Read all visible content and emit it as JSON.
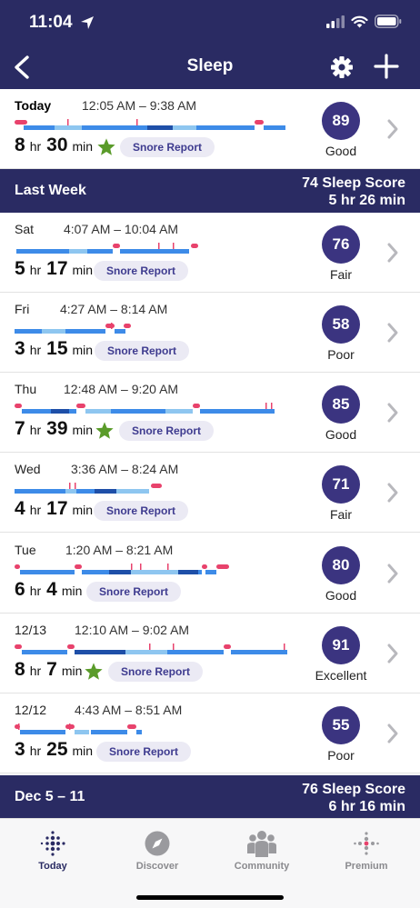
{
  "status_bar": {
    "time": "11:04"
  },
  "nav": {
    "title": "Sleep"
  },
  "today": {
    "day": "Today",
    "range": "12:05 AM – 9:38 AM",
    "hr": "8",
    "hr_unit": "hr",
    "min": "30",
    "min_unit": "min",
    "snore": "Snore Report",
    "score": "89",
    "label": "Good",
    "star": true
  },
  "weeks": [
    {
      "name": "Last Week",
      "score_line": "74 Sleep Score",
      "duration_line": "5 hr 26 min"
    },
    {
      "name": "Dec 5 – 11",
      "score_line": "76 Sleep Score",
      "duration_line": "6 hr 16 min"
    }
  ],
  "nights": [
    {
      "day": "Sat",
      "range": "4:07 AM – 10:04 AM",
      "hr": "5",
      "hr_unit": "hr",
      "min": "17",
      "min_unit": "min",
      "snore": "Snore Report",
      "score": "76",
      "label": "Fair",
      "star": false
    },
    {
      "day": "Fri",
      "range": "4:27 AM – 8:14 AM",
      "hr": "3",
      "hr_unit": "hr",
      "min": "15",
      "min_unit": "min",
      "snore": "Snore Report",
      "score": "58",
      "label": "Poor",
      "star": false
    },
    {
      "day": "Thu",
      "range": "12:48 AM – 9:20 AM",
      "hr": "7",
      "hr_unit": "hr",
      "min": "39",
      "min_unit": "min",
      "snore": "Snore Report",
      "score": "85",
      "label": "Good",
      "star": true
    },
    {
      "day": "Wed",
      "range": "3:36 AM – 8:24 AM",
      "hr": "4",
      "hr_unit": "hr",
      "min": "17",
      "min_unit": "min",
      "snore": "Snore Report",
      "score": "71",
      "label": "Fair",
      "star": false
    },
    {
      "day": "Tue",
      "range": "1:20 AM – 8:21 AM",
      "hr": "6",
      "hr_unit": "hr",
      "min": "4",
      "min_unit": "min",
      "snore": "Snore Report",
      "score": "80",
      "label": "Good",
      "star": false
    },
    {
      "day": "12/13",
      "range": "12:10 AM – 9:02 AM",
      "hr": "8",
      "hr_unit": "hr",
      "min": "7",
      "min_unit": "min",
      "snore": "Snore Report",
      "score": "91",
      "label": "Excellent",
      "star": true
    },
    {
      "day": "12/12",
      "range": "4:43 AM – 8:51 AM",
      "hr": "3",
      "hr_unit": "hr",
      "min": "25",
      "min_unit": "min",
      "snore": "Snore Report",
      "score": "55",
      "label": "Poor",
      "star": false
    }
  ],
  "tabs": [
    {
      "label": "Today",
      "icon": "fitbit-dots-icon"
    },
    {
      "label": "Discover",
      "icon": "compass-icon"
    },
    {
      "label": "Community",
      "icon": "people-icon"
    },
    {
      "label": "Premium",
      "icon": "premium-dots-icon"
    }
  ],
  "colors": {
    "navy": "#2a2b63",
    "score_circle": "#3b3480",
    "awake": "#e8426c",
    "rem": "#8ec6f0",
    "light": "#3d8be8",
    "deep": "#1e4fa8",
    "star": "#5a9b2a"
  }
}
